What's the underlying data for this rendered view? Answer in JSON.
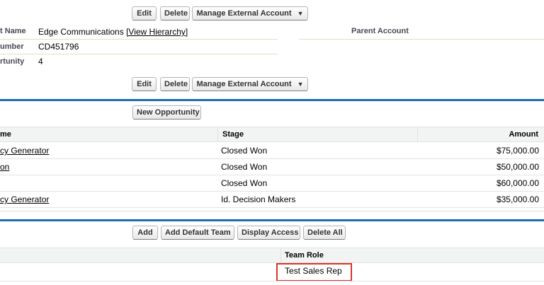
{
  "detail_buttons": {
    "edit": "Edit",
    "delete": "Delete",
    "manage_external": "Manage External Account",
    "caret": "▼"
  },
  "detail": {
    "account_name_label": "t Name",
    "account_name_value": "Edge Communications",
    "view_hierarchy": "[View Hierarchy]",
    "parent_account_label": "Parent Account",
    "account_number_label": "umber",
    "account_number_value": "CD451796",
    "opportunity_label": "rtunity",
    "opportunity_value": "4"
  },
  "opportunities": {
    "new_button": "New Opportunity",
    "columns": [
      "me",
      "Stage",
      "Amount"
    ],
    "rows": [
      {
        "name": "cy Generator",
        "stage": "Closed Won",
        "amount": "$75,000.00"
      },
      {
        "name": "on",
        "stage": "Closed Won",
        "amount": "$50,000.00"
      },
      {
        "name": "",
        "stage": "Closed Won",
        "amount": "$60,000.00"
      },
      {
        "name": "cy Generator",
        "stage": "Id. Decision Makers",
        "amount": "$35,000.00"
      }
    ]
  },
  "team": {
    "buttons": {
      "add": "Add",
      "add_default": "Add Default Team",
      "display_access": "Display Access",
      "delete_all": "Delete All"
    },
    "columns": [
      "Team Role"
    ],
    "rows": [
      {
        "role": "Test Sales Rep"
      }
    ],
    "highlight_color": "#d9342b"
  },
  "colors": {
    "section_border": "#1f6bb5"
  }
}
